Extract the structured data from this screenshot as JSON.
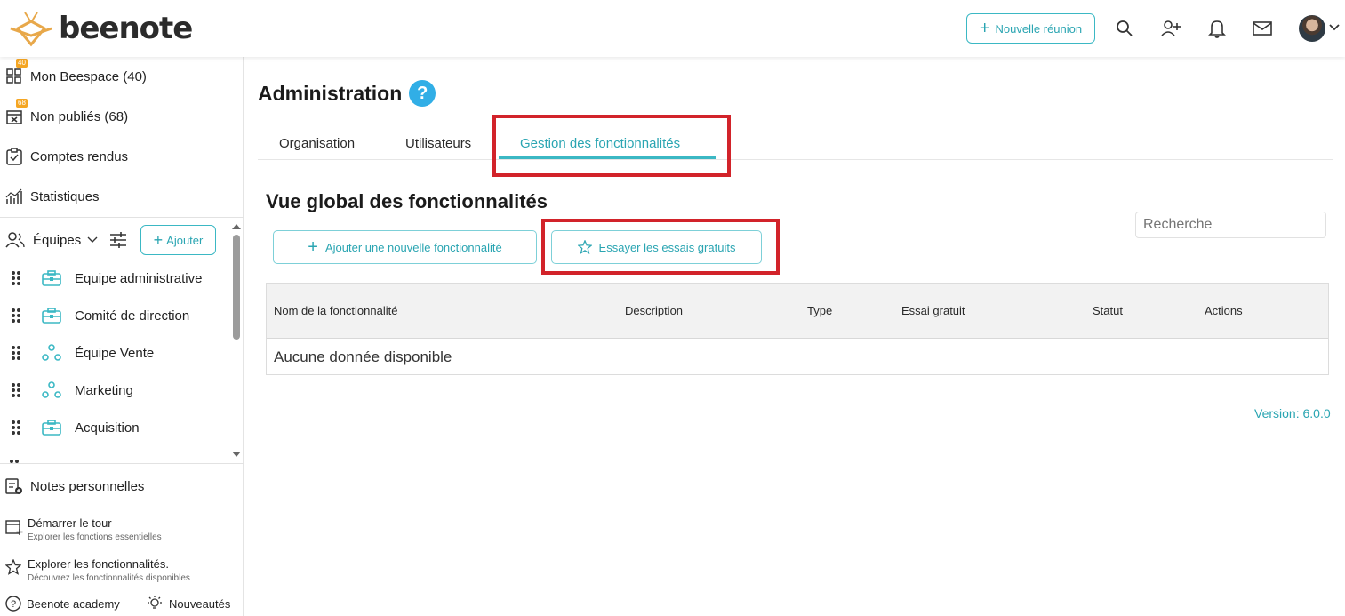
{
  "header": {
    "logo_text": "beenote",
    "new_meeting_label": "Nouvelle réunion"
  },
  "sidebar": {
    "nav": [
      {
        "label": "Mon Beespace (40)",
        "badge": "40",
        "icon": "grid-icon"
      },
      {
        "label": "Non publiés (68)",
        "badge": "68",
        "icon": "calendar-x-icon"
      },
      {
        "label": "Comptes rendus",
        "icon": "clipboard-check-icon"
      },
      {
        "label": "Statistiques",
        "icon": "chart-icon"
      }
    ],
    "teams_label": "Équipes",
    "add_label": "Ajouter",
    "teams": [
      {
        "label": "Equipe administrative",
        "icon": "briefcase-icon"
      },
      {
        "label": "Comité de direction",
        "icon": "briefcase-icon"
      },
      {
        "label": "Équipe Vente",
        "icon": "group-icon"
      },
      {
        "label": "Marketing",
        "icon": "group-icon"
      },
      {
        "label": "Acquisition",
        "icon": "briefcase-icon"
      }
    ],
    "notes_label": "Notes personnelles",
    "tour": {
      "title": "Démarrer le tour",
      "subtitle": "Explorer les fonctions essentielles"
    },
    "explore": {
      "title": "Explorer les fonctionnalités.",
      "subtitle": "Découvrez les fonctionnalités disponibles"
    },
    "academy_label": "Beenote academy",
    "news_label": "Nouveautés"
  },
  "main": {
    "title": "Administration",
    "help_symbol": "?",
    "tabs": [
      {
        "label": "Organisation"
      },
      {
        "label": "Utilisateurs"
      },
      {
        "label": "Gestion des fonctionnalités",
        "active": true
      }
    ],
    "section_title": "Vue global des fonctionnalités",
    "search_placeholder": "Recherche",
    "add_feature_label": "Ajouter une nouvelle fonctionnalité",
    "try_trials_label": "Essayer les essais gratuits",
    "table": {
      "columns": [
        "Nom de la fonctionnalité",
        "Description",
        "Type",
        "Essai gratuit",
        "Statut",
        "Actions"
      ],
      "empty_text": "Aucune donnée disponible"
    },
    "version": "Version: 6.0.0"
  },
  "colors": {
    "accent": "#2aa5b2",
    "highlight_box": "#d2232a",
    "badge": "#f5a623",
    "help": "#31aee6"
  }
}
